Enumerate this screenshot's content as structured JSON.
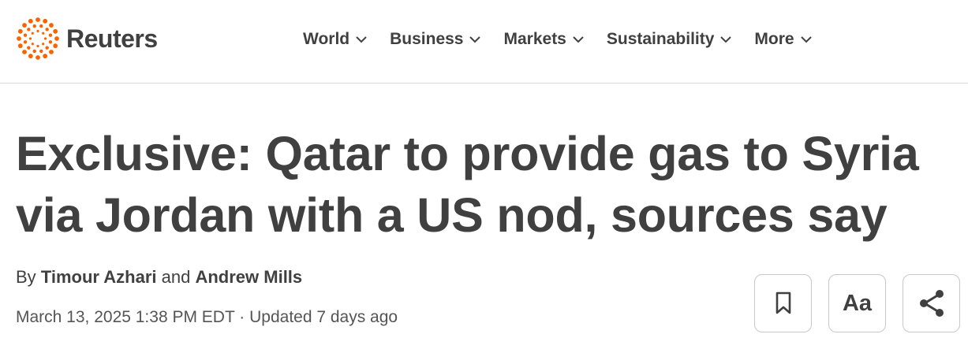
{
  "brand": {
    "name": "Reuters",
    "accent_color": "#fa6400"
  },
  "nav": {
    "items": [
      {
        "label": "World"
      },
      {
        "label": "Business"
      },
      {
        "label": "Markets"
      },
      {
        "label": "Sustainability"
      },
      {
        "label": "More"
      }
    ]
  },
  "article": {
    "headline_line1": "Exclusive: Qatar to provide gas to Syria",
    "headline_line2": "via Jordan with a US nod, sources say",
    "byline_prefix": "By",
    "author1": "Timour Azhari",
    "byline_joiner": "and",
    "author2": "Andrew Mills",
    "date": "March 13, 2025 1:38 PM EDT",
    "separator": "·",
    "updated": "Updated 7 days ago"
  },
  "actions": {
    "bookmark_icon": "bookmark-icon",
    "text_size_label": "Aa",
    "share_icon": "share-icon"
  }
}
